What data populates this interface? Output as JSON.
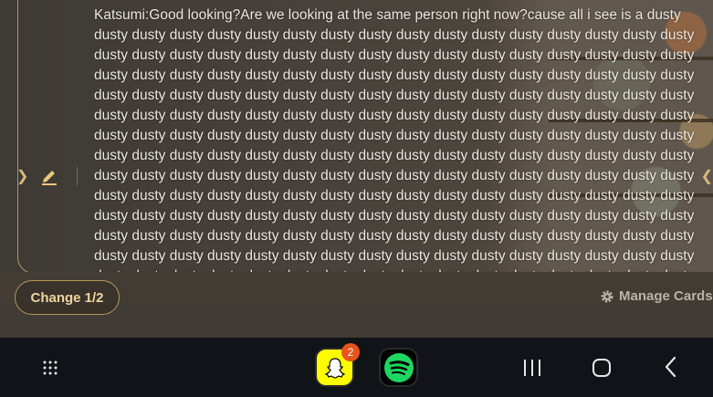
{
  "message": {
    "text": "Katsumi:Good looking?Are we looking at the same person right now?cause all i see is a dusty dusty dusty dusty dusty dusty dusty dusty dusty dusty dusty dusty dusty dusty dusty dusty dusty dusty dusty dusty dusty dusty dusty dusty dusty dusty dusty dusty dusty dusty dusty dusty dusty dusty dusty dusty dusty dusty dusty dusty dusty dusty dusty dusty dusty dusty dusty dusty dusty dusty dusty dusty dusty dusty dusty dusty dusty dusty dusty dusty dusty dusty dusty dusty dusty dusty dusty dusty dusty dusty dusty dusty dusty dusty dusty dusty dusty dusty dusty dusty dusty dusty dusty dusty dusty dusty dusty dusty dusty dusty dusty dusty dusty dusty dusty dusty dusty dusty dusty dusty dusty dusty dusty dusty dusty dusty dusty dusty dusty dusty dusty dusty dusty dusty dusty dusty dusty dusty dusty dusty dusty dusty dusty dusty dusty dusty dusty dusty dusty dusty dusty dusty dusty dusty dusty dusty dusty dusty dusty dusty dusty dusty dusty dusty dusty dusty dusty dusty dusty dusty dusty dusty dusty dusty dusty dusty dusty dusty dusty dusty dusty dusty dusty dusty dusty dusty dusty dusty dusty dusty dusty dusty dusty dusty dusty dusty dusty dusty dusty dusty dusty dusty dusty dusty dusty dusty dusty dusty dusty dusty dusty dusty dusty dusty dusty dusty dusty dusty dusty dusty dusty dusty dusty dusty dusty dusty dusty dusty dusty dusty dusty dusty dusty dusty dusty dusty dusty dusty dusty dusty dusty dusty dusty dusty dusty dusty dusty dusty"
  },
  "controls": {
    "change_label": "Change 1/2",
    "manage_label": "Manage Cards"
  },
  "icons": {
    "edit": "pencil-icon",
    "prev": "chevron-left-icon",
    "next": "chevron-right-icon",
    "settings": "gear-icon"
  },
  "taskbar": {
    "snapchat_badge": "2",
    "apps": [
      "snapchat",
      "spotify"
    ]
  },
  "colors": {
    "accent": "#d8b97e",
    "button_text": "#f0d49c",
    "navbar_bg": "#101419"
  }
}
